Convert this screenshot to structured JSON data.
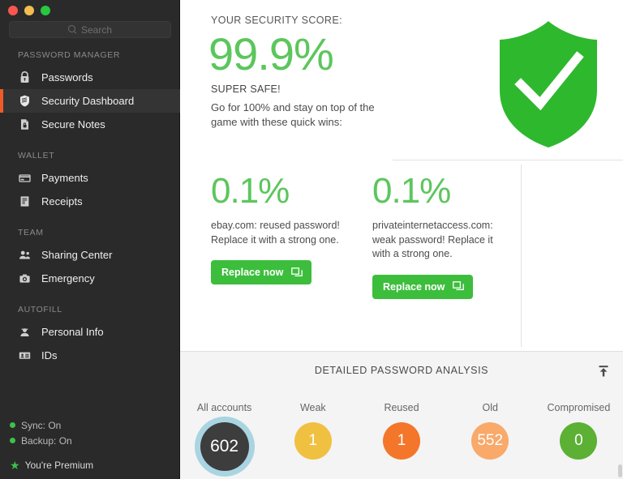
{
  "window": {
    "controls": [
      "close",
      "minimize",
      "zoom"
    ]
  },
  "search": {
    "placeholder": "Search",
    "value": ""
  },
  "sidebar": {
    "groups": [
      {
        "title": "PASSWORD MANAGER",
        "items": [
          {
            "label": "Passwords",
            "icon": "lock-icon",
            "active": false
          },
          {
            "label": "Security Dashboard",
            "icon": "shield-icon",
            "active": true
          },
          {
            "label": "Secure Notes",
            "icon": "secure-note-icon",
            "active": false
          }
        ]
      },
      {
        "title": "WALLET",
        "items": [
          {
            "label": "Payments",
            "icon": "credit-card-icon",
            "active": false
          },
          {
            "label": "Receipts",
            "icon": "receipt-icon",
            "active": false
          }
        ]
      },
      {
        "title": "TEAM",
        "items": [
          {
            "label": "Sharing Center",
            "icon": "people-icon",
            "active": false
          },
          {
            "label": "Emergency",
            "icon": "first-aid-kit-icon",
            "active": false
          }
        ]
      },
      {
        "title": "AUTOFILL",
        "items": [
          {
            "label": "Personal Info",
            "icon": "person-icon",
            "active": false
          },
          {
            "label": "IDs",
            "icon": "id-card-icon",
            "active": false
          }
        ]
      }
    ],
    "status": {
      "sync": "Sync: On",
      "backup": "Backup: On",
      "premium": "You're Premium"
    }
  },
  "main": {
    "score_label": "YOUR SECURITY SCORE:",
    "score_value": "99.9%",
    "score_sub": "SUPER SAFE!",
    "score_desc": "Go for 100% and stay on top of the game with these quick wins:",
    "shield_icon": "shield-check-icon",
    "cards": [
      {
        "percent": "0.1%",
        "description": "ebay.com: reused password! Replace it with a strong one.",
        "button_label": "Replace now",
        "button_icon": "open-window-icon"
      },
      {
        "percent": "0.1%",
        "description": "privateinternetaccess.com: weak password! Replace it with a strong one.",
        "button_label": "Replace now",
        "button_icon": "open-window-icon"
      }
    ]
  },
  "panel": {
    "title": "DETAILED PASSWORD ANALYSIS",
    "collapse_icon": "arrow-up-to-bar-icon"
  },
  "chart_data": {
    "type": "bar",
    "title": "DETAILED PASSWORD ANALYSIS",
    "categories": [
      "All accounts",
      "Weak",
      "Reused",
      "Old",
      "Compromised"
    ],
    "values": [
      602,
      1,
      1,
      552,
      0
    ],
    "display": "bubbles",
    "colors": [
      "#3d3d3d",
      "#f0c040",
      "#f4762a",
      "#f9a96a",
      "#5cb033"
    ],
    "ring_color": "#a9d4e2",
    "xlabel": "",
    "ylabel": "",
    "legend": "none"
  },
  "colors": {
    "accent_green": "#3cbe3c",
    "score_green": "#5cc65c",
    "sidebar_bg": "#2a2a2a",
    "active_bar": "#f05a28",
    "panel_bg": "#f4f4f4"
  }
}
